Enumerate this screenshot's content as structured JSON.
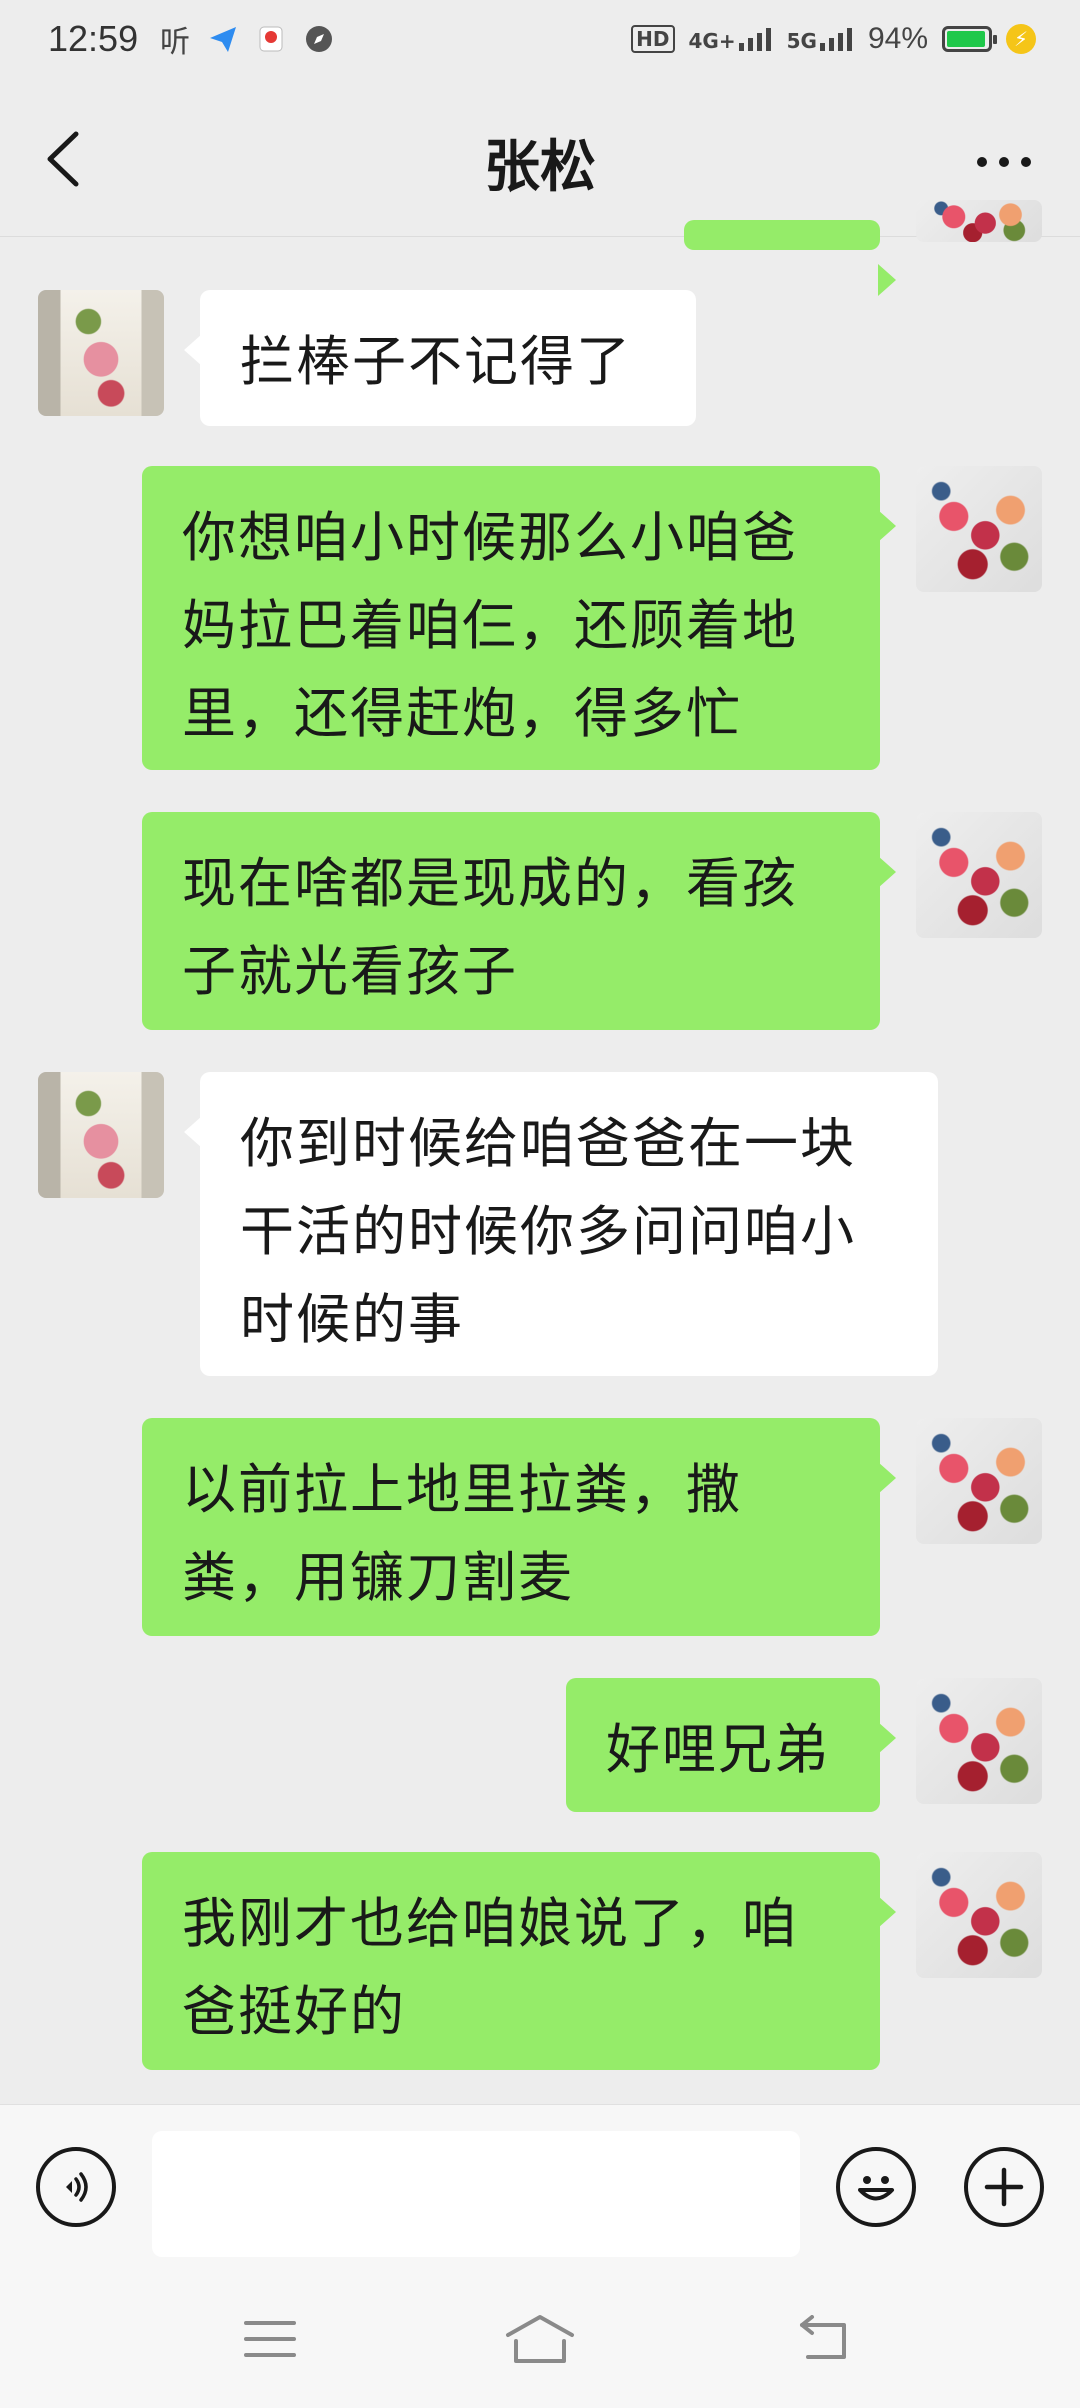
{
  "status_bar": {
    "time": "12:59",
    "app_icons": [
      "听"
    ],
    "network_1": "4G+",
    "network_2": "5G",
    "hd_label": "HD",
    "battery_percent": "94%",
    "battery_level": 0.94
  },
  "header": {
    "title": "张松"
  },
  "messages": [
    {
      "side": "out",
      "text": ""
    },
    {
      "side": "in",
      "text": "拦棒子不记得了"
    },
    {
      "side": "out",
      "text": "你想咱小时候那么小咱爸妈拉巴着咱仨，还顾着地里，还得赶炮，得多忙"
    },
    {
      "side": "out",
      "text": "现在啥都是现成的，看孩子就光看孩子"
    },
    {
      "side": "in",
      "text": "你到时候给咱爸爸在一块干活的时候你多问问咱小时候的事"
    },
    {
      "side": "out",
      "text": "以前拉上地里拉粪，撒粪，用镰刀割麦"
    },
    {
      "side": "out",
      "text": "好哩兄弟"
    },
    {
      "side": "out",
      "text": "我刚才也给咱娘说了，咱爸挺好的"
    }
  ],
  "input": {
    "placeholder": ""
  },
  "colors": {
    "outgoing_bubble": "#95ec69",
    "incoming_bubble": "#ffffff",
    "background": "#ededed"
  }
}
